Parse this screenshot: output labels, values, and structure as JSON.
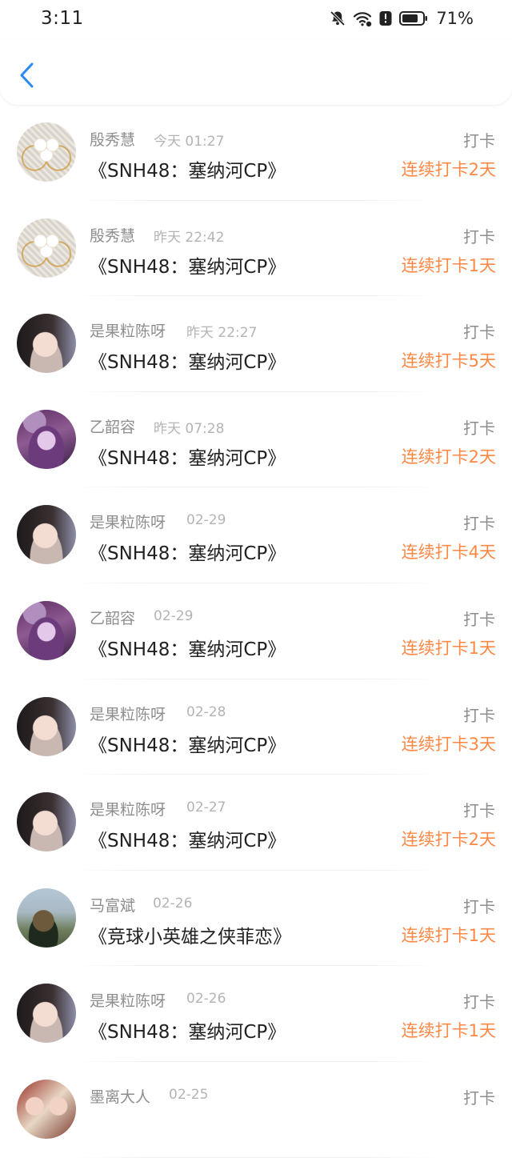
{
  "status_bar": {
    "time": "3:11",
    "battery_percent": "71%",
    "icons": [
      "bell-muted-icon",
      "wifi-icon",
      "battery-saver-icon",
      "battery-icon"
    ]
  },
  "nav": {
    "back_icon": "chevron-left-icon",
    "accent_color": "#2a8af6"
  },
  "colors": {
    "streak": "#ff8845",
    "secondary_text": "#8e8e8e",
    "time_text": "#b4b4b4"
  },
  "items": [
    {
      "name": "殷秀慧",
      "time": "今天 01:27",
      "title": "《SNH48：塞纳河CP》",
      "action": "打卡",
      "streak": "连续打卡2天",
      "avatar": "pearl"
    },
    {
      "name": "殷秀慧",
      "time": "昨天 22:42",
      "title": "《SNH48：塞纳河CP》",
      "action": "打卡",
      "streak": "连续打卡1天",
      "avatar": "pearl"
    },
    {
      "name": "是果粒陈呀",
      "time": "昨天 22:27",
      "title": "《SNH48：塞纳河CP》",
      "action": "打卡",
      "streak": "连续打卡5天",
      "avatar": "girl"
    },
    {
      "name": "乙韶容",
      "time": "昨天 07:28",
      "title": "《SNH48：塞纳河CP》",
      "action": "打卡",
      "streak": "连续打卡2天",
      "avatar": "anime"
    },
    {
      "name": "是果粒陈呀",
      "time": "02-29",
      "title": "《SNH48：塞纳河CP》",
      "action": "打卡",
      "streak": "连续打卡4天",
      "avatar": "girl"
    },
    {
      "name": "乙韶容",
      "time": "02-29",
      "title": "《SNH48：塞纳河CP》",
      "action": "打卡",
      "streak": "连续打卡1天",
      "avatar": "anime"
    },
    {
      "name": "是果粒陈呀",
      "time": "02-28",
      "title": "《SNH48：塞纳河CP》",
      "action": "打卡",
      "streak": "连续打卡3天",
      "avatar": "girl"
    },
    {
      "name": "是果粒陈呀",
      "time": "02-27",
      "title": "《SNH48：塞纳河CP》",
      "action": "打卡",
      "streak": "连续打卡2天",
      "avatar": "girl"
    },
    {
      "name": "马富斌",
      "time": "02-26",
      "title": "《竞球小英雄之侠菲恋》",
      "action": "打卡",
      "streak": "连续打卡1天",
      "avatar": "outdoor"
    },
    {
      "name": "是果粒陈呀",
      "time": "02-26",
      "title": "《SNH48：塞纳河CP》",
      "action": "打卡",
      "streak": "连续打卡1天",
      "avatar": "girl"
    },
    {
      "name": "墨离大人",
      "time": "02-25",
      "title": "",
      "action": "打卡",
      "streak": "",
      "avatar": "art"
    }
  ]
}
